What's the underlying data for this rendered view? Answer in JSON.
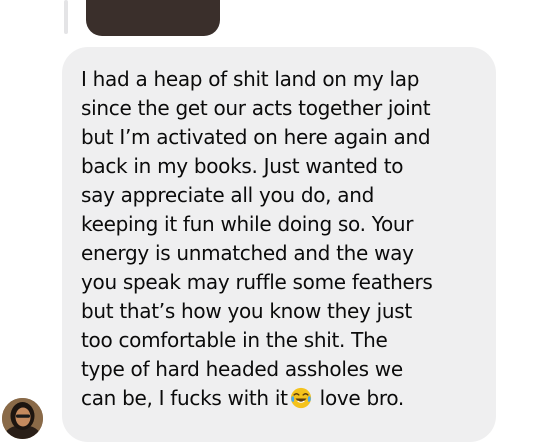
{
  "conversation": {
    "replied_media": {
      "icon": "photo-thumbnail"
    },
    "message": {
      "lines": [
        "I had a heap of shit land on my lap",
        "since the get our acts together joint",
        "but I’m activated on here again and",
        "back in my books. Just wanted to",
        "say appreciate all you do, and",
        "keeping it fun while doing so. Your",
        "energy is unmatched and the way",
        "you speak may ruffle some feathers",
        "but that’s how you know they just",
        "too comfortable in the shit. The",
        "type of hard headed assholes we"
      ],
      "last_line_before_emoji": "can be, I fucks with it",
      "emoji": "face-with-tears-of-joy-icon",
      "last_line_after_emoji": " love bro.",
      "bubble_color": "#efeff0",
      "text_color": "#0b0b0b"
    },
    "sender": {
      "avatar_icon": "profile-avatar"
    }
  }
}
